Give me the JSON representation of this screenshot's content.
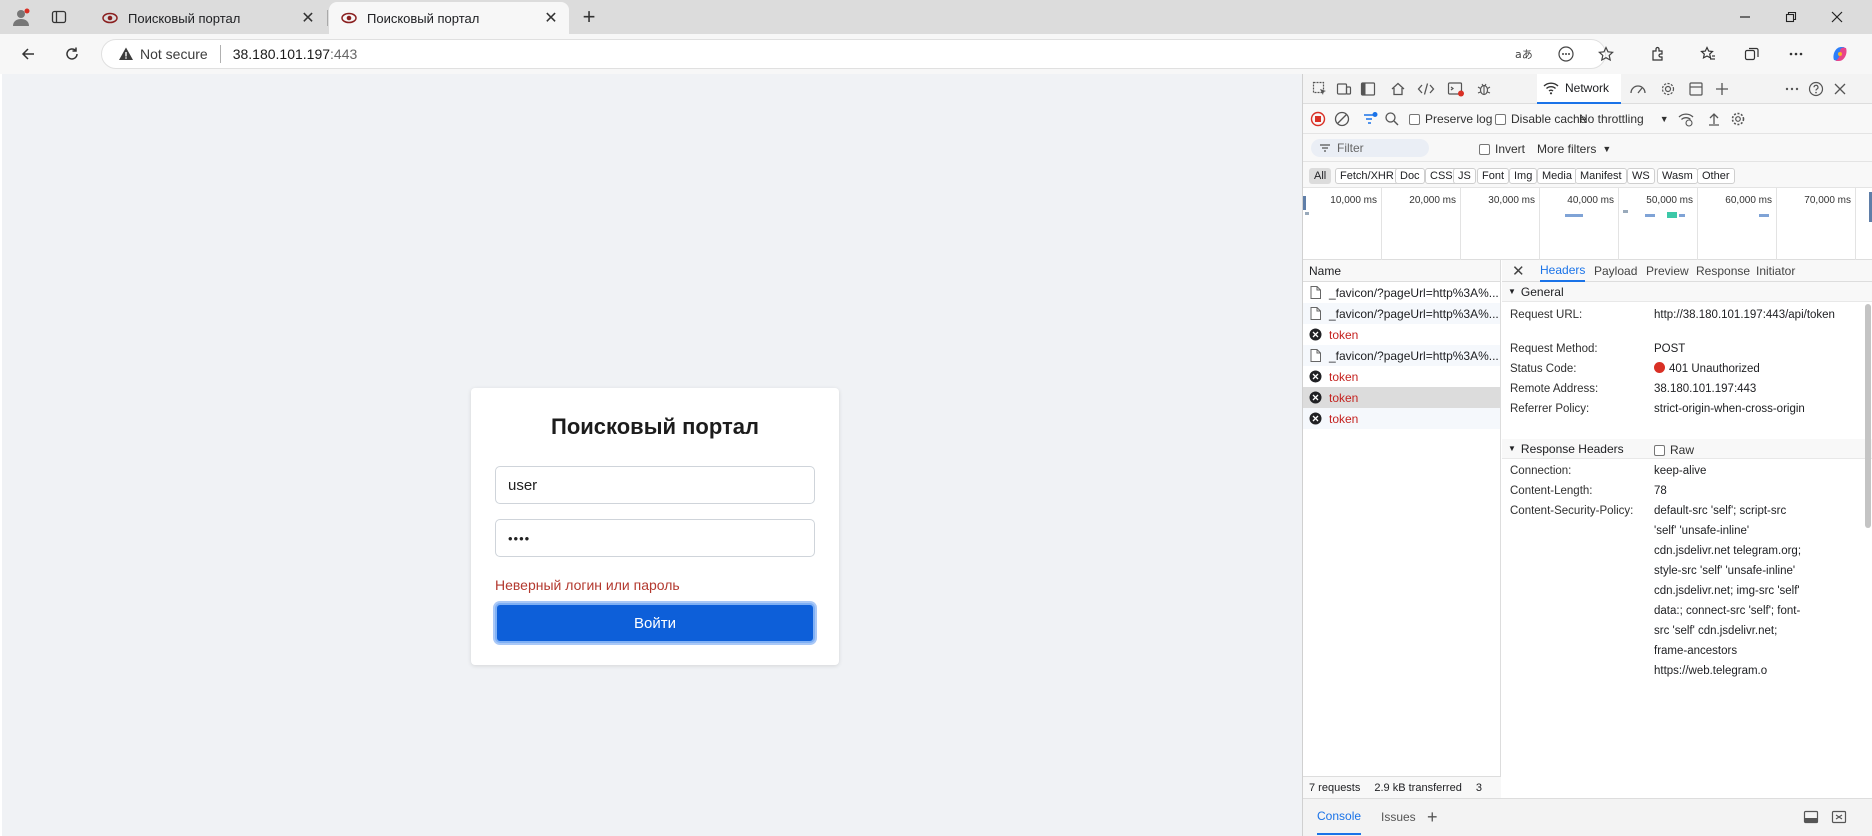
{
  "browser": {
    "tabs": [
      {
        "title": "Поисковый портал",
        "active": false
      },
      {
        "title": "Поисковый портал",
        "active": true
      }
    ],
    "address": {
      "security_label": "Not secure",
      "host": "38.180.101.197",
      "port": ":443"
    }
  },
  "page": {
    "title": "Поисковый портал",
    "username_value": "user",
    "password_mask": "••••",
    "error": "Неверный логин или пароль",
    "submit_label": "Войти"
  },
  "devtools": {
    "active_panel": "Network",
    "toolbar": {
      "preserve_log": "Preserve log",
      "disable_cache": "Disable cache",
      "throttling": "No throttling"
    },
    "filter": {
      "placeholder": "Filter",
      "invert": "Invert",
      "more_filters": "More filters"
    },
    "type_filters": [
      "All",
      "Fetch/XHR",
      "Doc",
      "CSS",
      "JS",
      "Font",
      "Img",
      "Media",
      "Manifest",
      "WS",
      "Wasm",
      "Other"
    ],
    "timeline_labels": [
      "10,000 ms",
      "20,000 ms",
      "30,000 ms",
      "40,000 ms",
      "50,000 ms",
      "60,000 ms",
      "70,000 ms"
    ],
    "name_header": "Name",
    "requests": [
      {
        "name": "_favicon/?pageUrl=http%3A%...",
        "error": false
      },
      {
        "name": "_favicon/?pageUrl=http%3A%...",
        "error": false
      },
      {
        "name": "token",
        "error": true
      },
      {
        "name": "_favicon/?pageUrl=http%3A%...",
        "error": false
      },
      {
        "name": "token",
        "error": true
      },
      {
        "name": "token",
        "error": true
      },
      {
        "name": "token",
        "error": true
      }
    ],
    "status": {
      "requests": "7 requests",
      "transferred": "2.9 kB transferred",
      "extra": "3"
    },
    "detail_tabs": [
      "Headers",
      "Payload",
      "Preview",
      "Response",
      "Initiator"
    ],
    "general": {
      "heading": "General",
      "rows": [
        {
          "key": "Request URL:",
          "value": "http://38.180.101.197:443/api/token"
        },
        {
          "key": "Request Method:",
          "value": "POST"
        },
        {
          "key": "Status Code:",
          "value": "401 Unauthorized"
        },
        {
          "key": "Remote Address:",
          "value": "38.180.101.197:443"
        },
        {
          "key": "Referrer Policy:",
          "value": "strict-origin-when-cross-origin"
        }
      ]
    },
    "response_headers": {
      "heading": "Response Headers",
      "raw_label": "Raw",
      "rows": [
        {
          "key": "Connection:",
          "value": "keep-alive"
        },
        {
          "key": "Content-Length:",
          "value": "78"
        },
        {
          "key": "Content-Security-Policy:",
          "value": "default-src 'self'; script-src 'self' 'unsafe-inline' cdn.jsdelivr.net telegram.org; style-src 'self' 'unsafe-inline' cdn.jsdelivr.net; img-src 'self' data:; connect-src 'self'; font-src 'self' cdn.jsdelivr.net; frame-ancestors https://web.telegram.o"
        }
      ]
    },
    "drawer_tabs": [
      "Console",
      "Issues"
    ]
  },
  "colors": {
    "primary_button": "#0d5fd9",
    "error_text": "#b3392f",
    "devtools_accent": "#1a73e8",
    "status_error": "#d93025"
  }
}
